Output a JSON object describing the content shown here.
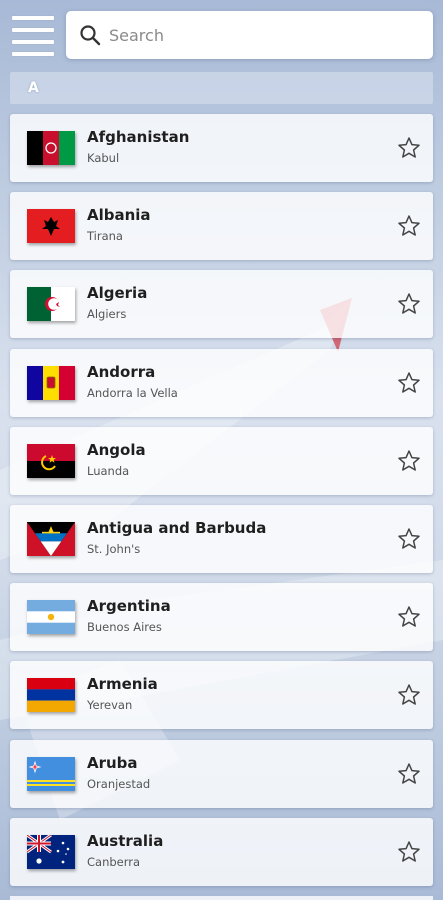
{
  "search": {
    "placeholder": "Search",
    "value": ""
  },
  "section": {
    "letter": "A"
  },
  "countries": [
    {
      "name": "Afghanistan",
      "capital": "Kabul",
      "flag": "afghanistan-flag"
    },
    {
      "name": "Albania",
      "capital": "Tirana",
      "flag": "albania-flag"
    },
    {
      "name": "Algeria",
      "capital": "Algiers",
      "flag": "algeria-flag"
    },
    {
      "name": "Andorra",
      "capital": "Andorra la Vella",
      "flag": "andorra-flag"
    },
    {
      "name": "Angola",
      "capital": "Luanda",
      "flag": "angola-flag"
    },
    {
      "name": "Antigua and Barbuda",
      "capital": "St. John's",
      "flag": "antigua-and-barbuda-flag"
    },
    {
      "name": "Argentina",
      "capital": "Buenos Aires",
      "flag": "argentina-flag"
    },
    {
      "name": "Armenia",
      "capital": "Yerevan",
      "flag": "armenia-flag"
    },
    {
      "name": "Aruba",
      "capital": "Oranjestad",
      "flag": "aruba-flag"
    },
    {
      "name": "Australia",
      "capital": "Canberra",
      "flag": "australia-flag"
    }
  ],
  "icons": {
    "menu": "hamburger-menu-icon",
    "search": "search-icon",
    "favorite": "star-outline-icon"
  },
  "colors": {
    "card_background": "#ffffff",
    "text_primary": "#1f1f1f",
    "text_secondary": "#555555"
  }
}
